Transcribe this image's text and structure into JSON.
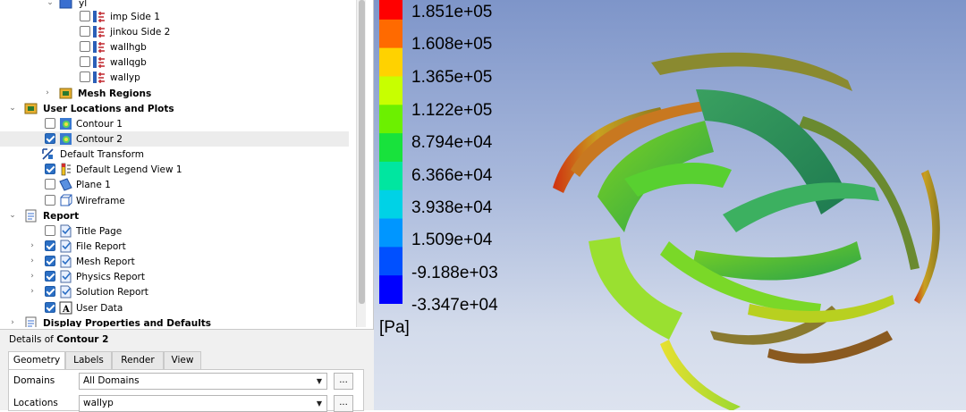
{
  "tree": {
    "rows": [
      {
        "label": "yl",
        "bold": false
      },
      {
        "label": "imp Side 1",
        "bold": false
      },
      {
        "label": "jinkou Side 2",
        "bold": false
      },
      {
        "label": "wallhgb",
        "bold": false
      },
      {
        "label": "wallqgb",
        "bold": false
      },
      {
        "label": "wallyp",
        "bold": false
      },
      {
        "label": "Mesh Regions",
        "bold": true
      },
      {
        "label": "User Locations and Plots",
        "bold": true
      },
      {
        "label": "Contour 1",
        "bold": false
      },
      {
        "label": "Contour 2",
        "bold": false
      },
      {
        "label": "Default Transform",
        "bold": false
      },
      {
        "label": "Default Legend View 1",
        "bold": false
      },
      {
        "label": "Plane 1",
        "bold": false
      },
      {
        "label": "Wireframe",
        "bold": false
      },
      {
        "label": "Report",
        "bold": true
      },
      {
        "label": "Title Page",
        "bold": false
      },
      {
        "label": "File Report",
        "bold": false
      },
      {
        "label": "Mesh Report",
        "bold": false
      },
      {
        "label": "Physics Report",
        "bold": false
      },
      {
        "label": "Solution Report",
        "bold": false
      },
      {
        "label": "User Data",
        "bold": false
      },
      {
        "label": "Display Properties and Defaults",
        "bold": true
      }
    ]
  },
  "details": {
    "prefix": "Details of ",
    "object": "Contour 2",
    "tabs": [
      "Geometry",
      "Labels",
      "Render",
      "View"
    ],
    "active_tab": "Geometry",
    "domains_label": "Domains",
    "domains_value": "All Domains",
    "locations_label": "Locations",
    "locations_value": "wallyp",
    "dots": "..."
  },
  "legend": {
    "labels": [
      "1.851e+05",
      "1.608e+05",
      "1.365e+05",
      "1.122e+05",
      "8.794e+04",
      "6.366e+04",
      "3.938e+04",
      "1.509e+04",
      "-9.188e+03",
      "-3.347e+04"
    ],
    "unit": "[Pa]",
    "colors": [
      "#ff0000",
      "#ff6a00",
      "#ffd200",
      "#c8ff00",
      "#6cf000",
      "#18e23c",
      "#00e6a0",
      "#00d2e6",
      "#0096ff",
      "#0050ff",
      "#0000ff"
    ]
  }
}
